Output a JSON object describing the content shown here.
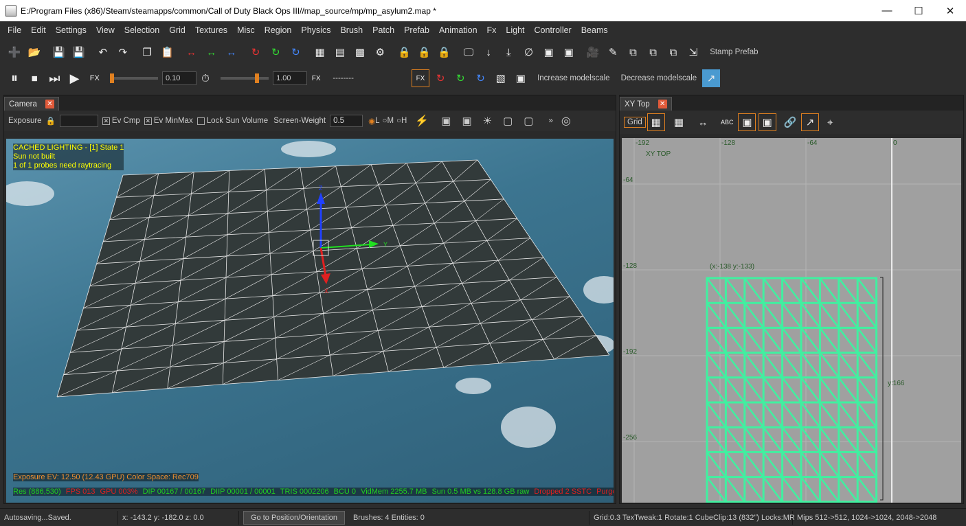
{
  "window": {
    "title": "E:/Program Files (x86)/Steam/steamapps/common/Call of Duty Black Ops III//map_source/mp/mp_asylum2.map *"
  },
  "menu": [
    "File",
    "Edit",
    "Settings",
    "View",
    "Selection",
    "Grid",
    "Textures",
    "Misc",
    "Region",
    "Physics",
    "Brush",
    "Patch",
    "Prefab",
    "Animation",
    "Fx",
    "Light",
    "Controller",
    "Beams"
  ],
  "toolbar1": {
    "stamp_prefab": "Stamp Prefab"
  },
  "toolbar2": {
    "fx_time_value": "0.10",
    "time_scale_value": "1.00",
    "fx_dashes": "--------",
    "increase_modelscale": "Increase modelscale",
    "decrease_modelscale": "Decrease modelscale"
  },
  "camera": {
    "tab": "Camera",
    "exposure_label": "Exposure",
    "ev_cmp": "Ev Cmp",
    "ev_minmax": "Ev MinMax",
    "lock_sun": "Lock Sun Volume",
    "screen_weight_label": "Screen-Weight",
    "screen_weight_value": "0.5",
    "lmh": [
      "L",
      "M",
      "H"
    ],
    "overlay_lines": [
      "CACHED LIGHTING - [1] State 1",
      "Sun not built",
      "1 of 1 probes need raytracing"
    ],
    "exposure_info": "Exposure EV: 12.50 (12.43 GPU)   Color Space: Rec709",
    "stats": [
      {
        "text": "Res (886,530)",
        "color": "#20d020"
      },
      {
        "text": "FPS 013",
        "color": "#e02020"
      },
      {
        "text": "GPU 003%",
        "color": "#e02020"
      },
      {
        "text": "DIP 00167 / 00167",
        "color": "#20d020"
      },
      {
        "text": "DIIP 00001 / 00001",
        "color": "#20d020"
      },
      {
        "text": "TRIS 0002206",
        "color": "#20d020"
      },
      {
        "text": "BCU 0",
        "color": "#20d020"
      },
      {
        "text": "VidMem 2255.7 MB",
        "color": "#20d020"
      },
      {
        "text": "Sun 0.5 MB vs 128.8 GB raw",
        "color": "#20d020"
      },
      {
        "text": "Dropped 2 SSTC",
        "color": "#e02020"
      },
      {
        "text": "Purge Su",
        "color": "#e02020"
      }
    ],
    "gizmo": {
      "x": "X",
      "y": "Y",
      "z": "Z"
    }
  },
  "xy": {
    "tab": "XY Top",
    "grid_btn": "Grid",
    "view_label": "XY TOP",
    "x_ticks": [
      "-192",
      "-128",
      "-64",
      "0"
    ],
    "y_ticks": [
      "-64",
      "-128",
      "-192",
      "-256"
    ],
    "coord_label": "(x:-138  y:-133)",
    "size_label": "y:166"
  },
  "status": {
    "autosave": "Autosaving...Saved.",
    "coords": "x: -143.2  y: -182.0  z: 0.0",
    "goto": "Go to Position/Orientation",
    "counts": "Brushes: 4 Entities: 0",
    "grid": "Grid:0.3 TexTweak:1 Rotate:1 CubeClip:13 (832\") Locks:MR",
    "mips": "Mips 512->512, 1024->1024, 2048->2048"
  },
  "colors": {
    "accent_orange": "#e08020",
    "patch_green": "#40f0a0",
    "ocean": "#3c7590",
    "xy_bg": "#a0a0a0"
  }
}
